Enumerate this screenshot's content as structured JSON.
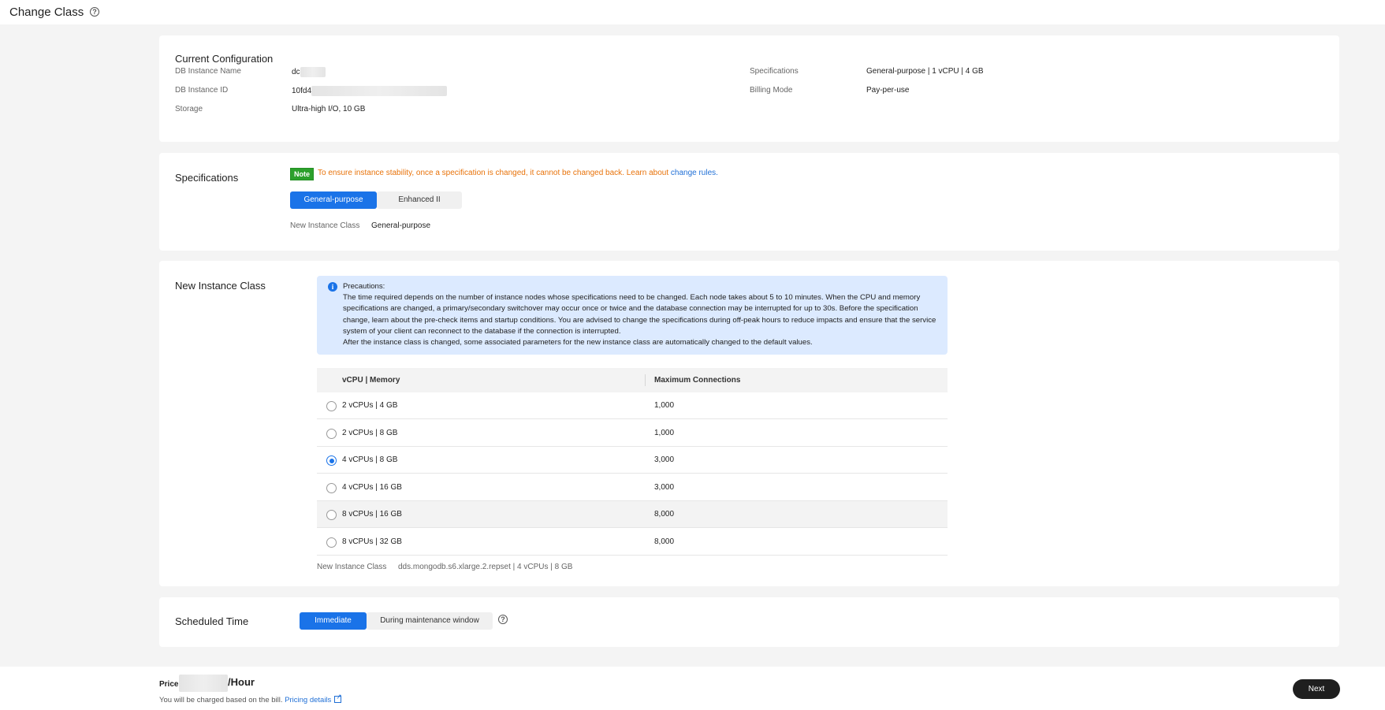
{
  "page": {
    "title": "Change Class",
    "help_icon": "question-circle-icon"
  },
  "current_config": {
    "title": "Current Configuration",
    "db_instance_name_label": "DB Instance Name",
    "db_instance_name_value": "dc",
    "db_instance_id_label": "DB Instance ID",
    "db_instance_id_value": "10fd4",
    "storage_label": "Storage",
    "storage_value": "Ultra-high I/O, 10 GB",
    "specifications_label": "Specifications",
    "specifications_value": "General-purpose | 1 vCPU | 4 GB",
    "billing_mode_label": "Billing Mode",
    "billing_mode_value": "Pay-per-use"
  },
  "specifications": {
    "title": "Specifications",
    "note_badge": "Note",
    "note_text": "To ensure instance stability, once a specification is changed, it cannot be changed back. Learn about ",
    "note_link": "change rules.",
    "options": [
      "General-purpose",
      "Enhanced II"
    ],
    "selected": "General-purpose",
    "new_class_label": "New Instance Class",
    "new_class_value": "General-purpose"
  },
  "new_instance_class": {
    "title": "New Instance Class",
    "precautions_title": "Precautions:",
    "precautions_body": "The time required depends on the number of instance nodes whose specifications need to be changed. Each node takes about 5 to 10 minutes. When the CPU and memory specifications are changed, a primary/secondary switchover may occur once or twice and the database connection may be interrupted for up to 30s. Before the specification change, learn about the pre-check items and startup conditions. You are advised to change the specifications during off-peak hours to reduce impacts and ensure that the service system of your client can reconnect to the database if the connection is interrupted.",
    "precautions_footer": "After the instance class is changed, some associated parameters for the new instance class are automatically changed to the default values.",
    "columns": [
      "vCPU | Memory",
      "Maximum Connections"
    ],
    "rows": [
      {
        "spec": "2 vCPUs | 4 GB",
        "max_conn": "1,000"
      },
      {
        "spec": "2 vCPUs | 8 GB",
        "max_conn": "1,000"
      },
      {
        "spec": "4 vCPUs | 8 GB",
        "max_conn": "3,000"
      },
      {
        "spec": "4 vCPUs | 16 GB",
        "max_conn": "3,000"
      },
      {
        "spec": "8 vCPUs | 16 GB",
        "max_conn": "8,000"
      },
      {
        "spec": "8 vCPUs | 32 GB",
        "max_conn": "8,000"
      }
    ],
    "selected_row": "4 vCPUs | 8 GB",
    "summary_label": "New Instance Class",
    "summary_value": "dds.mongodb.s6.xlarge.2.repset | 4 vCPUs | 8 GB"
  },
  "scheduled_time": {
    "title": "Scheduled Time",
    "options": [
      "Immediate",
      "During maintenance window"
    ],
    "selected": "Immediate"
  },
  "footer": {
    "price_label": "Price",
    "price_unit": "/Hour",
    "bill_note": "You will be charged based on the bill. ",
    "pricing_link": "Pricing details",
    "next_label": "Next"
  },
  "colors": {
    "primary": "#1a73e8",
    "note_green": "#2ca02c",
    "note_orange": "#e8730b",
    "link": "#1f6fd6",
    "dark_button": "#1f1f1f"
  }
}
